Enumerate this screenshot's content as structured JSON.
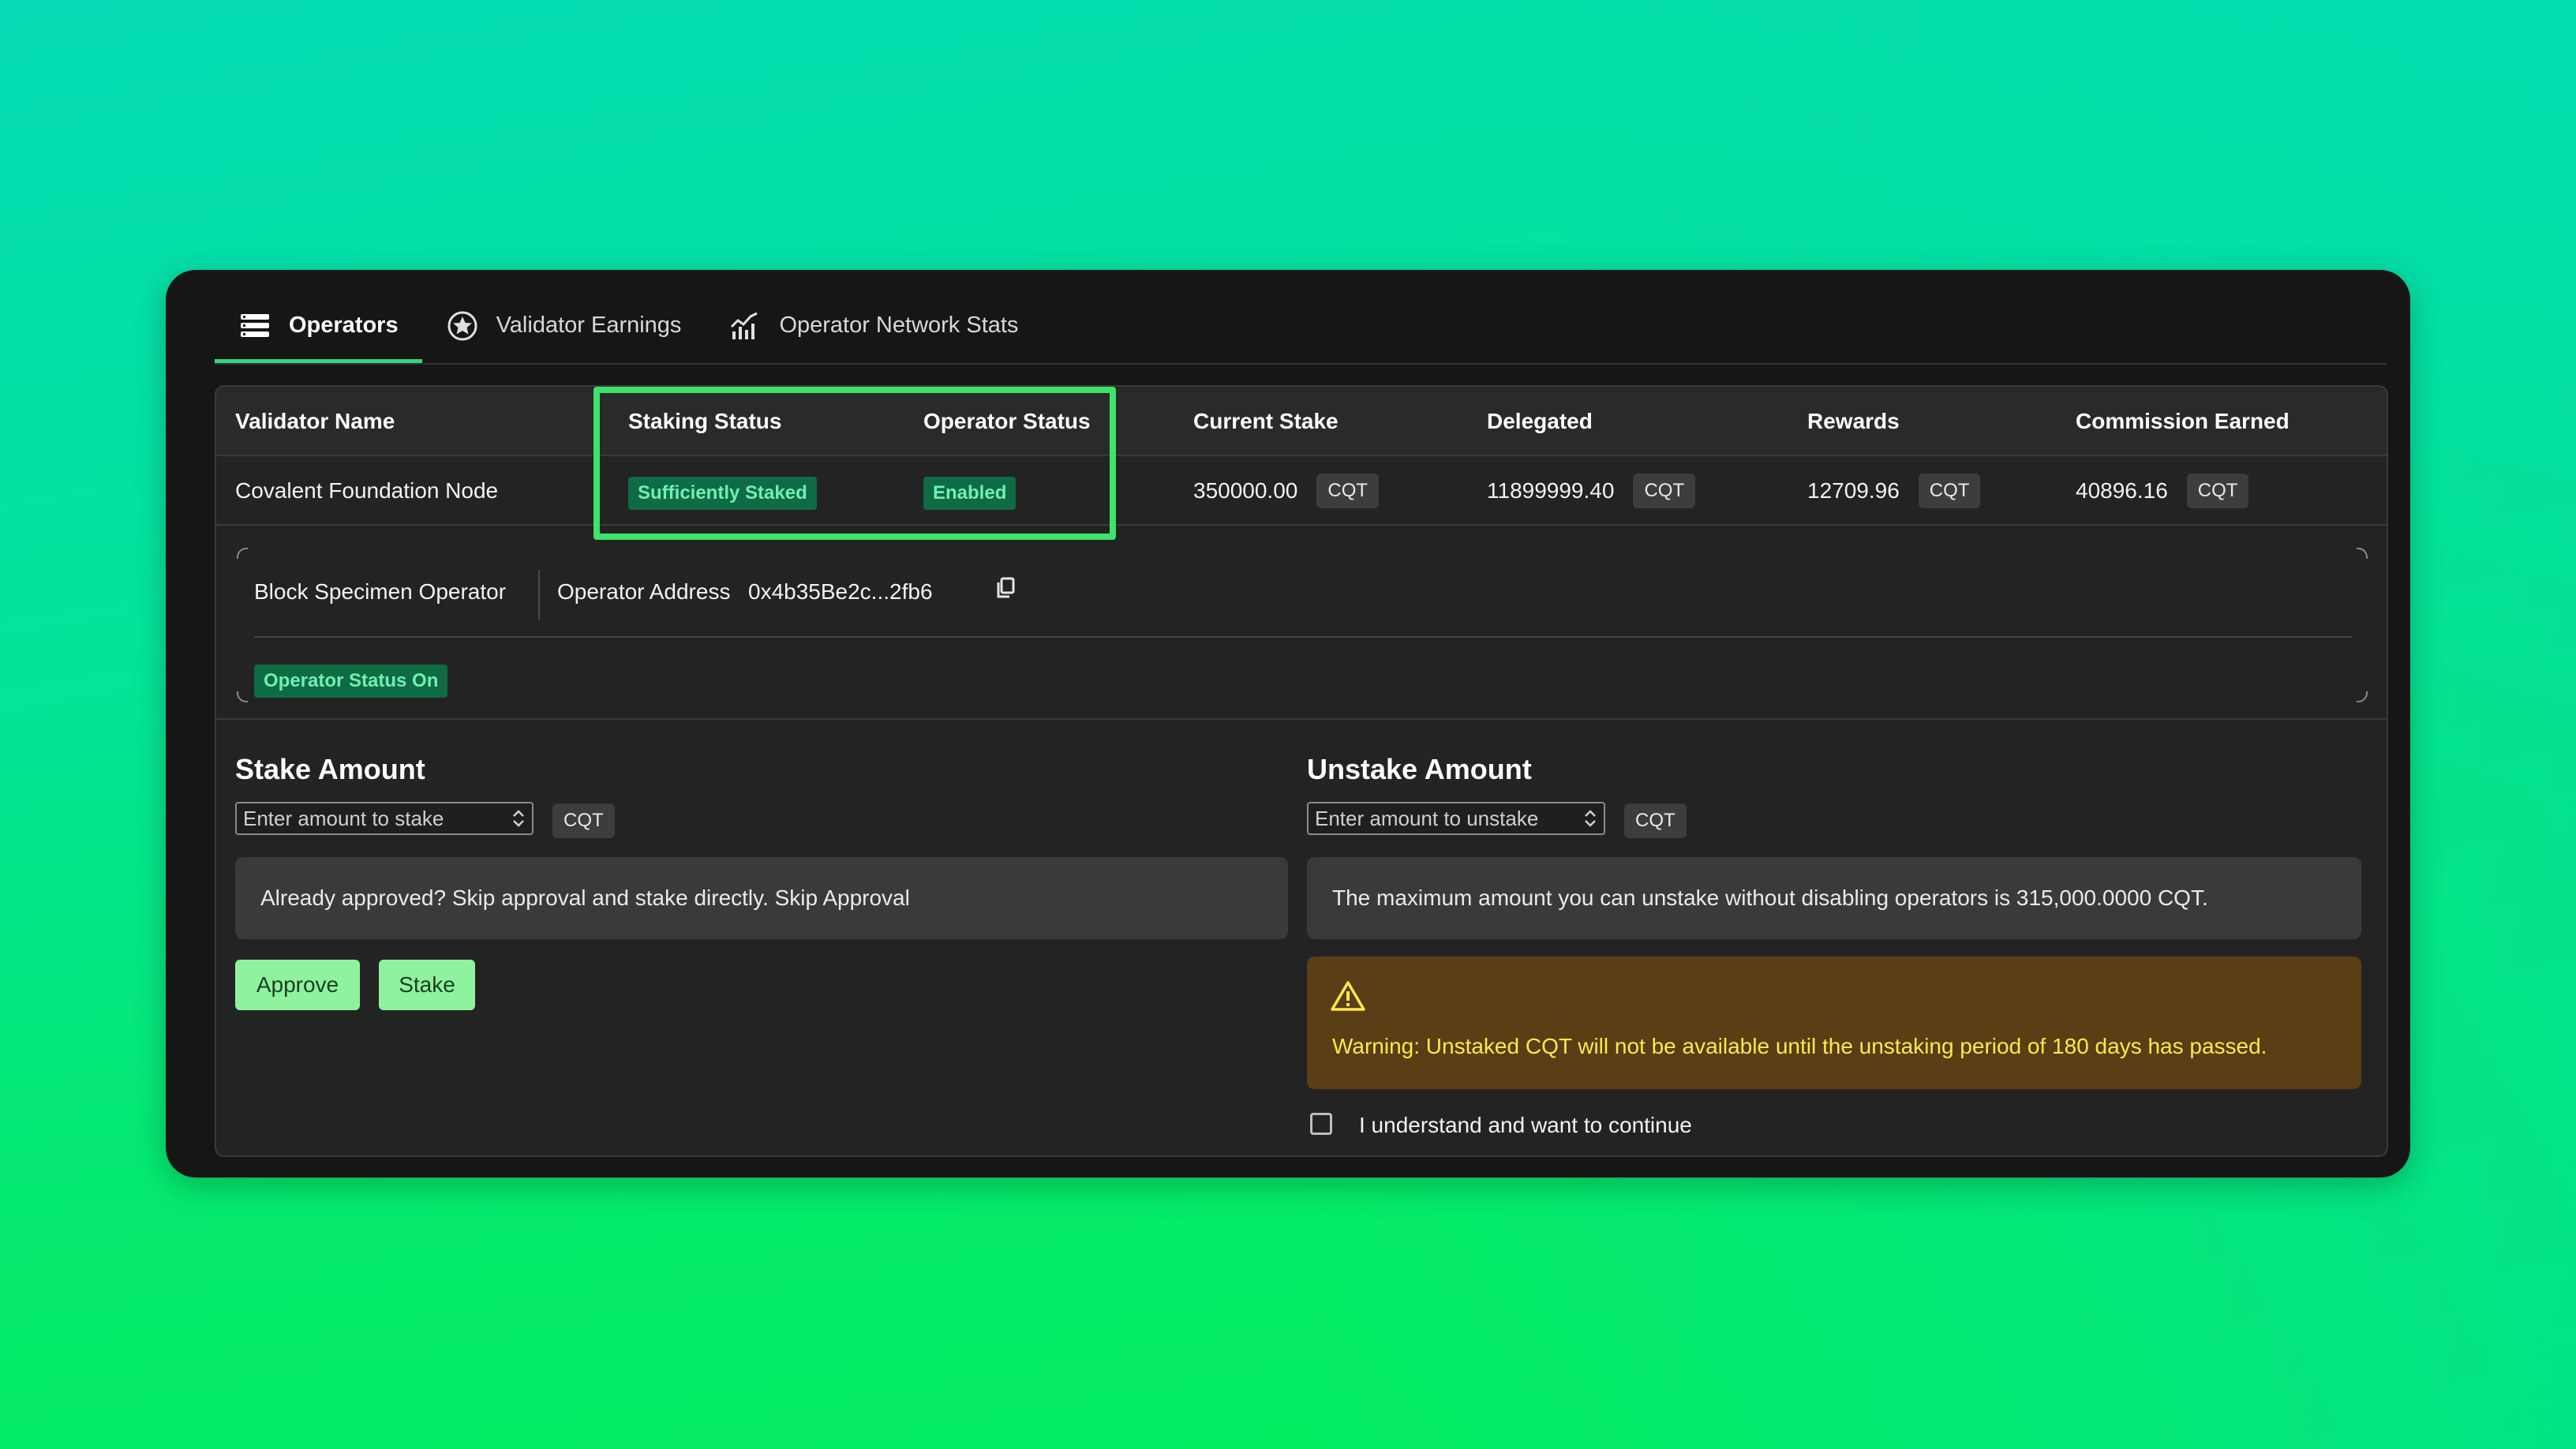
{
  "tabs": [
    {
      "label": "Operators",
      "icon": "list-icon",
      "active": true
    },
    {
      "label": "Validator Earnings",
      "icon": "star-circle-icon",
      "active": false
    },
    {
      "label": "Operator Network Stats",
      "icon": "bar-chart-icon",
      "active": false
    }
  ],
  "table": {
    "headers": {
      "validator_name": "Validator Name",
      "staking_status": "Staking Status",
      "operator_status": "Operator Status",
      "current_stake": "Current Stake",
      "delegated": "Delegated",
      "rewards": "Rewards",
      "commission_earned": "Commission Earned"
    },
    "row": {
      "validator_name": "Covalent Foundation Node",
      "staking_status": "Sufficiently Staked",
      "operator_status": "Enabled",
      "current_stake": "350000.00",
      "delegated": "11899999.40",
      "rewards": "12709.96",
      "commission_earned": "40896.16",
      "unit": "CQT"
    }
  },
  "operator": {
    "type": "Block Specimen Operator",
    "address_label": "Operator Address",
    "address": "0x4b35Be2c...2fb6",
    "status": "Operator Status On"
  },
  "stake": {
    "title": "Stake Amount",
    "placeholder": "Enter amount to stake",
    "unit": "CQT",
    "info": "Already approved? Skip approval and stake directly. Skip Approval",
    "approve_label": "Approve",
    "stake_label": "Stake"
  },
  "unstake": {
    "title": "Unstake Amount",
    "placeholder": "Enter amount to unstake",
    "unit": "CQT",
    "info": "The maximum amount you can unstake without disabling operators is 315,000.0000 CQT.",
    "warning": "Warning: Unstaked CQT will not be available until the unstaking period of 180 days has passed.",
    "confirm_label": "I understand and want to continue"
  },
  "colors": {
    "accent_green": "#34d57e",
    "highlight_border": "#3ee36b",
    "warning_bg": "#5a3e15",
    "warning_text": "#ffe84a",
    "button_bg": "#8ef29e"
  }
}
